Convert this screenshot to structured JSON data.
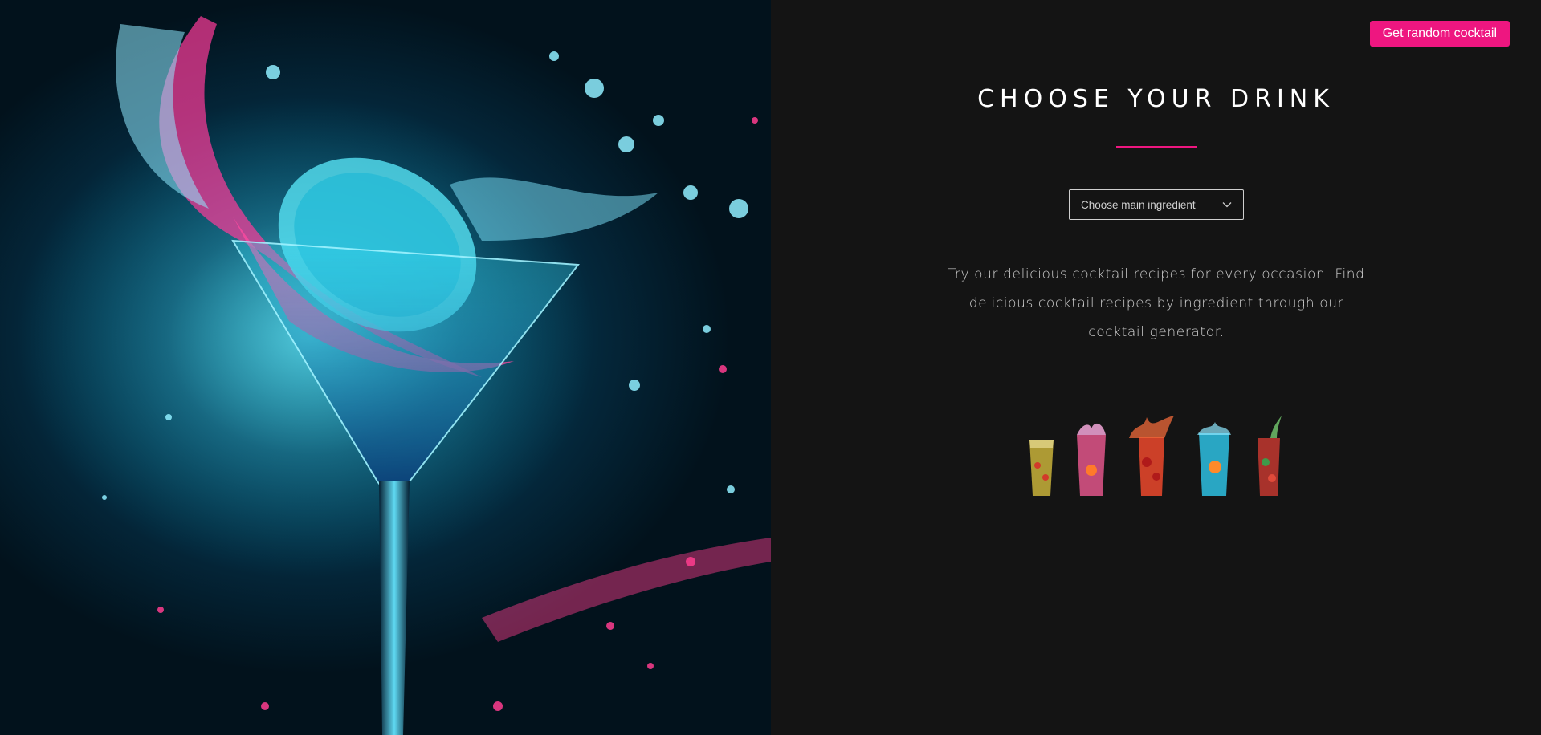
{
  "header": {
    "random_button_label": "Get random cocktail"
  },
  "main": {
    "title": "CHOOSE YOUR DRINK",
    "ingredient_select": {
      "selected_label": "Choose main ingredient"
    },
    "intro_text": "Try our delicious cocktail recipes for every occasion. Find delicious cocktail recipes by ingredient through our cocktail generator."
  },
  "images": {
    "hero": "cocktail-splash-photo",
    "glasses": [
      {
        "name": "cocktail-glass-yellow",
        "color": "#c8b23a"
      },
      {
        "name": "cocktail-glass-pink",
        "color": "#e0558a"
      },
      {
        "name": "cocktail-glass-red",
        "color": "#e0452a"
      },
      {
        "name": "cocktail-glass-blue",
        "color": "#2bb6d6"
      },
      {
        "name": "cocktail-glass-green",
        "color": "#b8352e"
      }
    ]
  },
  "colors": {
    "accent": "#ee1680",
    "background": "#141414",
    "text": "#cfcfcf"
  }
}
